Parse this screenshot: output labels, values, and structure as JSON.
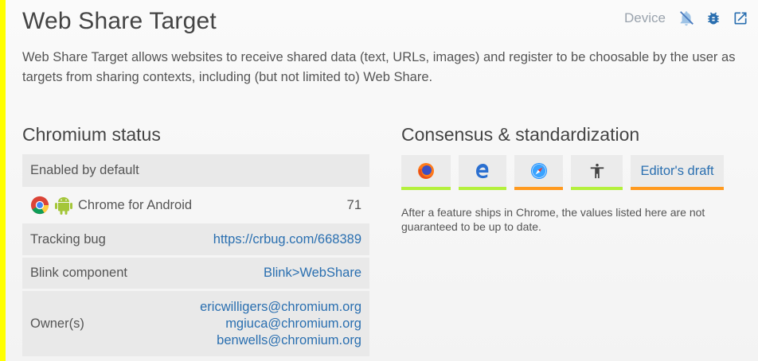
{
  "header": {
    "title": "Web Share Target",
    "device_label": "Device",
    "icons": [
      "bell-muted-icon",
      "bug-icon",
      "open-external-icon"
    ]
  },
  "description": "Web Share Target allows websites to receive shared data (text, URLs, images) and register to be choosable by the user as targets from sharing contexts, including (but not limited to) Web Share.",
  "chromium_status": {
    "heading": "Chromium status",
    "enabled_label": "Enabled by default",
    "platform_row": {
      "label": "Chrome for Android",
      "milestone": "71"
    },
    "tracking_bug": {
      "label": "Tracking bug",
      "value": "https://crbug.com/668389"
    },
    "blink_component": {
      "label": "Blink component",
      "value": "Blink>WebShare"
    },
    "owners": {
      "label": "Owner(s)",
      "values": [
        "ericwilligers@chromium.org",
        "mgiuca@chromium.org",
        "benwells@chromium.org"
      ]
    }
  },
  "consensus": {
    "heading": "Consensus & standardization",
    "editors_draft": "Editor's draft",
    "note": "After a feature ships in Chrome, the values listed here are not guaranteed to be up to date.",
    "status_colors": {
      "firefox": "#b4f03c",
      "edge": "#b4f03c",
      "safari": "#ff9a1f",
      "web_developers": "#b4f03c",
      "spec": "#ff9a1f"
    }
  },
  "colors": {
    "accent_yellow": "#ffff00",
    "link": "#2a6fb0"
  }
}
